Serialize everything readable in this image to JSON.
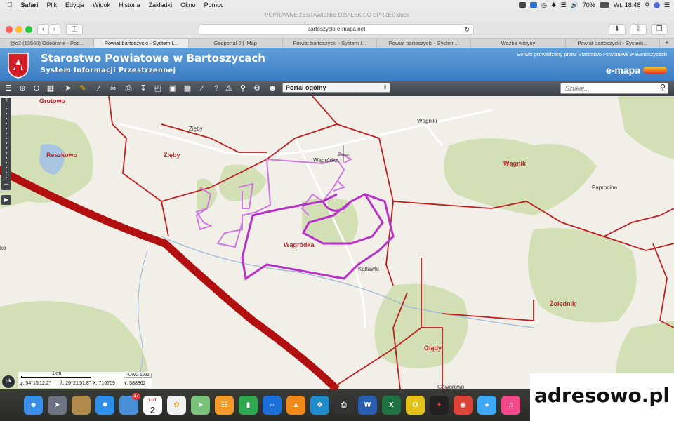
{
  "menubar": {
    "app": "Safari",
    "items": [
      "Plik",
      "Edycja",
      "Widok",
      "Historia",
      "Zakładki",
      "Okno",
      "Pomoc"
    ],
    "battery": "70%",
    "clock": "Wt. 18:48"
  },
  "window": {
    "title": "POPRAWNE ZESTAWIENIE DZIAŁEK DO SPRZED.docx",
    "url": "bartoszycki.e-mapa.net"
  },
  "tabs": [
    {
      "label": "@o2 (13560) Odebrane - Poc..."
    },
    {
      "label": "Powiat bartoszycki - System I...",
      "active": true
    },
    {
      "label": "Geoportal 2 | iMap"
    },
    {
      "label": "Powiat bartoszycki - System I..."
    },
    {
      "label": "Powiat bartoszycki - System..."
    },
    {
      "label": "Ważne witryny"
    },
    {
      "label": "Powiat bartoszycki - System..."
    }
  ],
  "header": {
    "title": "Starostwo Powiatowe w Bartoszycach",
    "subtitle": "System Informacji Przestrzennej",
    "service_note": "Serwis prowadzony przez Starostwo Powiatowe w Bartoszycach",
    "brand": "e-mapa"
  },
  "map_toolbar": {
    "portal_select": "Portal ogólny",
    "search_placeholder": "Szukaj..."
  },
  "map": {
    "regions": {
      "grotowo": "Grotowo",
      "reszkowo": "Reszkowo",
      "zieby": "Zięby",
      "wagrodka": "Wągródka",
      "wagnik": "Wągnik",
      "zolednik": "Żołędnik",
      "glady": "Glądy"
    },
    "villages": {
      "zieby": "Zięby",
      "wagniki": "Wągniki",
      "wagrodka": "Wągródka",
      "paprocina": "Paprocina",
      "katlawki": "Kątławki",
      "gaworowo": "Gaworowo",
      "edge_ko": "ko"
    }
  },
  "status": {
    "scale_label": "1km",
    "coord_system": "PUWG 1992",
    "lat": "φ: 54°15'12.2\"",
    "lon": "λ: 20°21'51.8\"",
    "x": "X: 710769",
    "y": "Y: 588862",
    "ok": "ok"
  },
  "dock": {
    "calendar_month": "LUT",
    "calendar_day": "2",
    "mail_badge": "27"
  },
  "watermark": "adresowo.pl",
  "colors": {
    "header_blue": "#3b7cc4",
    "boundary_red": "#c01f1f",
    "road_red": "#b21010",
    "parcel_purple": "#b730c9",
    "parcel_light_purple": "#cf78e0",
    "forest_green": "#d2dfb4"
  }
}
